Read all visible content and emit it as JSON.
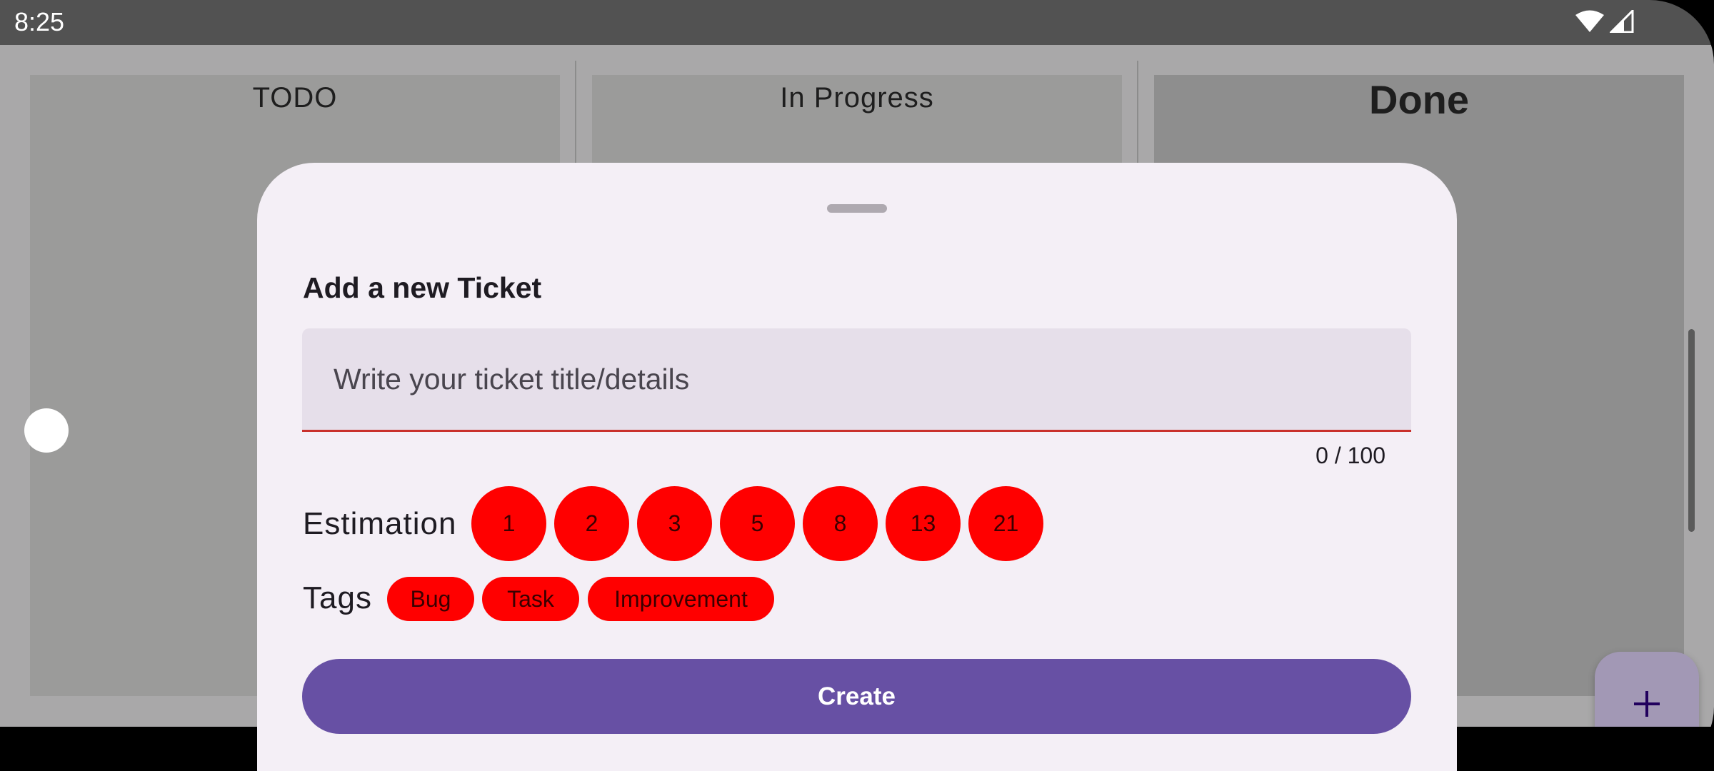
{
  "status_bar": {
    "time": "8:25",
    "icons": [
      "wifi-icon",
      "signal-icon"
    ]
  },
  "board": {
    "columns": [
      {
        "title": "TODO"
      },
      {
        "title": "In Progress"
      },
      {
        "title": "Done"
      }
    ]
  },
  "sheet": {
    "title": "Add a new Ticket",
    "input": {
      "placeholder": "Write your ticket title/details",
      "value": ""
    },
    "counter": "0 / 100",
    "estimation_label": "Estimation",
    "estimation_options": [
      "1",
      "2",
      "3",
      "5",
      "8",
      "13",
      "21"
    ],
    "tags_label": "Tags",
    "tags": [
      "Bug",
      "Task",
      "Improvement"
    ],
    "create_label": "Create"
  },
  "fab": {
    "icon": "plus-icon"
  },
  "colors": {
    "chip": "#ff0000",
    "primary": "#6750a4",
    "sheet_bg": "#f4eff6",
    "input_underline": "#c9302c"
  }
}
